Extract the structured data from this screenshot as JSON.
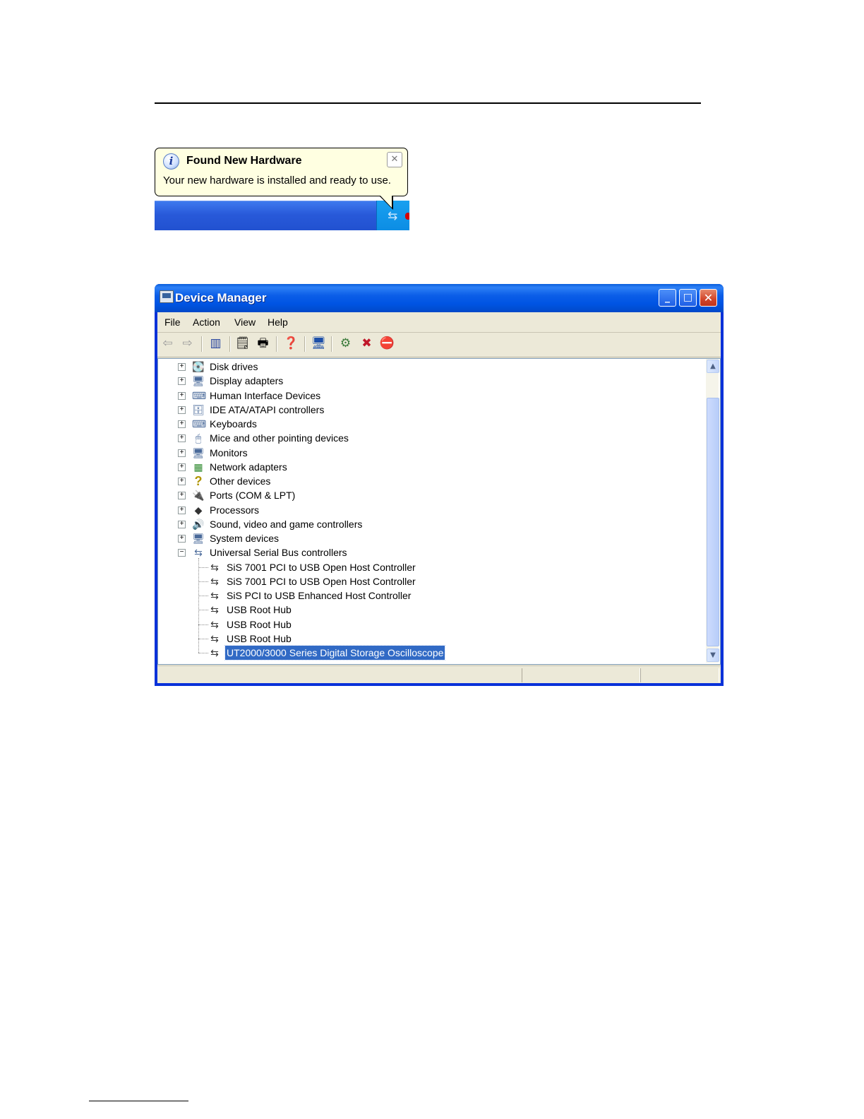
{
  "balloon": {
    "title": "Found New Hardware",
    "message": "Your new hardware is installed and ready to use.",
    "close_glyph": "✕",
    "icon": "info-icon"
  },
  "window": {
    "title": "Device Manager",
    "controls": {
      "minimize": "_",
      "maximize": "□",
      "close": "✕"
    }
  },
  "menu": [
    "File",
    "Action",
    "View",
    "Help"
  ],
  "toolbar": [
    {
      "name": "back-icon",
      "glyph": "⇦"
    },
    {
      "name": "forward-icon",
      "glyph": "⇨"
    },
    {
      "name": "show-hide-tree-icon",
      "glyph": "▥"
    },
    {
      "name": "properties-icon",
      "glyph": "🗒"
    },
    {
      "name": "print-icon",
      "glyph": "🖶"
    },
    {
      "name": "help-icon",
      "glyph": "❓"
    },
    {
      "name": "scan-hardware-icon",
      "glyph": "🖥"
    },
    {
      "name": "update-driver-icon",
      "glyph": "⚙"
    },
    {
      "name": "uninstall-icon",
      "glyph": "✖"
    },
    {
      "name": "disable-icon",
      "glyph": "⛔"
    }
  ],
  "tree": {
    "categories": [
      {
        "label": "Disk drives",
        "icon": "disk-drive-icon",
        "glyph": "💽"
      },
      {
        "label": "Display adapters",
        "icon": "display-adapter-icon",
        "glyph": "🖥"
      },
      {
        "label": "Human Interface Devices",
        "icon": "hid-icon",
        "glyph": "⌨"
      },
      {
        "label": "IDE ATA/ATAPI controllers",
        "icon": "ide-controller-icon",
        "glyph": "🗄"
      },
      {
        "label": "Keyboards",
        "icon": "keyboard-icon",
        "glyph": "⌨"
      },
      {
        "label": "Mice and other pointing devices",
        "icon": "mouse-icon",
        "glyph": "🖱"
      },
      {
        "label": "Monitors",
        "icon": "monitor-icon",
        "glyph": "🖥"
      },
      {
        "label": "Network adapters",
        "icon": "network-adapter-icon",
        "glyph": "▦"
      },
      {
        "label": "Other devices",
        "icon": "unknown-device-icon",
        "glyph": "?"
      },
      {
        "label": "Ports (COM & LPT)",
        "icon": "port-icon",
        "glyph": "🔌"
      },
      {
        "label": "Processors",
        "icon": "processor-icon",
        "glyph": "◆"
      },
      {
        "label": "Sound, video and game controllers",
        "icon": "sound-icon",
        "glyph": "🔊"
      },
      {
        "label": "System devices",
        "icon": "system-device-icon",
        "glyph": "🖥"
      },
      {
        "label": "Universal Serial Bus controllers",
        "icon": "usb-icon",
        "glyph": "⇆",
        "expanded": true
      }
    ],
    "usb_children": [
      {
        "label": "SiS 7001 PCI to USB Open Host Controller"
      },
      {
        "label": "SiS 7001 PCI to USB Open Host Controller"
      },
      {
        "label": "SiS PCI to USB Enhanced Host Controller"
      },
      {
        "label": "USB Root Hub"
      },
      {
        "label": "USB Root Hub"
      },
      {
        "label": "USB Root Hub"
      },
      {
        "label": "UT2000/3000 Series Digital Storage Oscilloscope",
        "selected": true
      }
    ],
    "expand_glyph": "+",
    "collapse_glyph": "−",
    "usb_glyph": "⇆"
  },
  "scrollbar": {
    "up": "▲",
    "down": "▼"
  }
}
